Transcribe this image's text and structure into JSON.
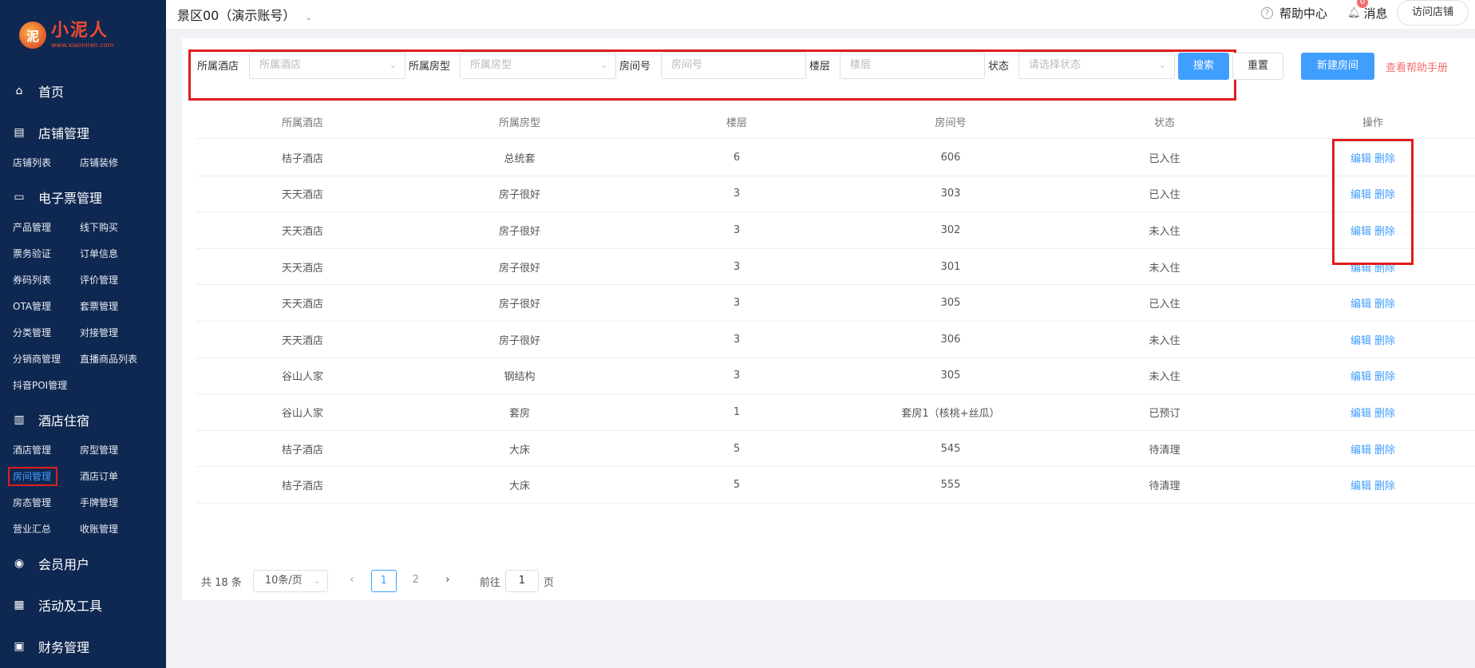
{
  "sidebar": {
    "logo": {
      "title": "小泥人",
      "sub": "www.xiaoniren.com",
      "mark": "泥"
    },
    "sections": [
      {
        "label": "首页",
        "icon": "home-icon",
        "glyph": "⌂"
      },
      {
        "label": "店铺管理",
        "icon": "store-icon",
        "glyph": "▤"
      },
      {
        "label": "电子票管理",
        "icon": "ticket-icon",
        "glyph": "▭"
      },
      {
        "label": "酒店住宿",
        "icon": "building-icon",
        "glyph": "▥"
      },
      {
        "label": "会员用户",
        "icon": "users-icon",
        "glyph": "◉"
      },
      {
        "label": "活动及工具",
        "icon": "chart-icon",
        "glyph": "▦"
      },
      {
        "label": "财务管理",
        "icon": "finance-icon",
        "glyph": "▣"
      }
    ],
    "store_items": [
      "店铺列表",
      "店铺装修"
    ],
    "ticket_items": [
      "产品管理",
      "线下购买",
      "票务验证",
      "订单信息",
      "券码列表",
      "评价管理",
      "OTA管理",
      "套票管理",
      "分类管理",
      "对接管理",
      "分销商管理",
      "直播商品列表",
      "抖音POI管理"
    ],
    "hotel_items": [
      "酒店管理",
      "房型管理",
      "房间管理",
      "酒店订单",
      "房态管理",
      "手牌管理",
      "营业汇总",
      "收账管理"
    ],
    "active_item": "房间管理"
  },
  "topbar": {
    "account": "景区00（演示账号）",
    "help": "帮助中心",
    "messages": "消息",
    "message_badge": "0",
    "visit_store": "访问店铺"
  },
  "filters": {
    "hotel_label": "所属酒店",
    "hotel_placeholder": "所属酒店",
    "roomtype_label": "所属房型",
    "roomtype_placeholder": "所属房型",
    "roomno_label": "房间号",
    "roomno_placeholder": "房间号",
    "floor_label": "楼层",
    "floor_placeholder": "楼层",
    "status_label": "状态",
    "status_placeholder": "请选择状态",
    "search": "搜索",
    "reset": "重置",
    "new_room": "新建房间",
    "help_manual": "查看帮助手册"
  },
  "table": {
    "headers": [
      "所属酒店",
      "所属房型",
      "楼层",
      "房间号",
      "状态",
      "操作"
    ],
    "edit": "编辑",
    "delete": "删除",
    "rows": [
      [
        "桔子酒店",
        "总统套",
        "6",
        "606",
        "已入住"
      ],
      [
        "天天酒店",
        "房子很好",
        "3",
        "303",
        "已入住"
      ],
      [
        "天天酒店",
        "房子很好",
        "3",
        "302",
        "未入住"
      ],
      [
        "天天酒店",
        "房子很好",
        "3",
        "301",
        "未入住"
      ],
      [
        "天天酒店",
        "房子很好",
        "3",
        "305",
        "已入住"
      ],
      [
        "天天酒店",
        "房子很好",
        "3",
        "306",
        "未入住"
      ],
      [
        "谷山人家",
        "钢结构",
        "3",
        "305",
        "未入住"
      ],
      [
        "谷山人家",
        "套房",
        "1",
        "套房1（核桃+丝瓜）",
        "已预订"
      ],
      [
        "桔子酒店",
        "大床",
        "5",
        "545",
        "待清理"
      ],
      [
        "桔子酒店",
        "大床",
        "5",
        "555",
        "待清理"
      ]
    ]
  },
  "pagination": {
    "total": "共 18 条",
    "page_size": "10条/页",
    "prev": "‹",
    "pages": [
      "1",
      "2"
    ],
    "next": "›",
    "goto_label": "前往",
    "goto_value": "1",
    "page_unit": "页"
  }
}
